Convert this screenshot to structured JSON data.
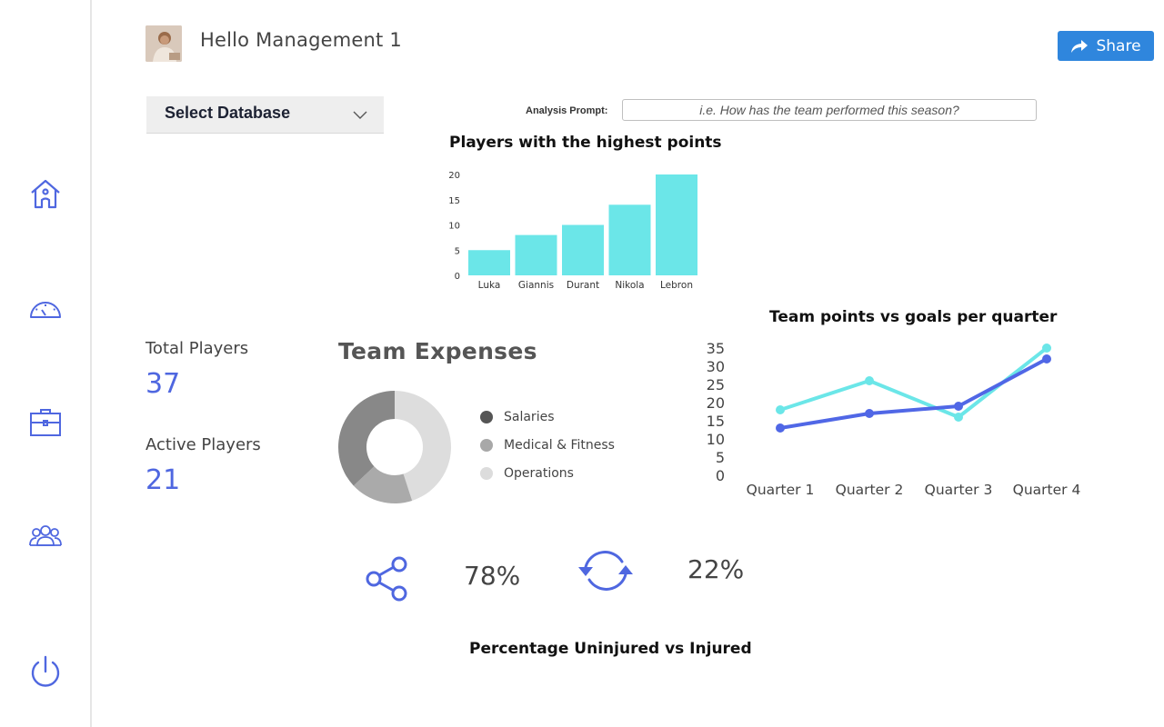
{
  "header": {
    "greeting": "Hello Management 1",
    "share_label": "Share"
  },
  "sidebar": {
    "items": [
      {
        "icon": "home-icon"
      },
      {
        "icon": "dashboard-gauge-icon"
      },
      {
        "icon": "briefcase-icon"
      },
      {
        "icon": "users-icon"
      },
      {
        "icon": "power-icon"
      }
    ]
  },
  "database_select": {
    "label": "Select Database"
  },
  "analysis": {
    "label": "Analysis Prompt:",
    "placeholder": "i.e. How has the team performed this season?"
  },
  "stats": {
    "total_players_label": "Total Players",
    "total_players_value": "37",
    "active_players_label": "Active Players",
    "active_players_value": "21"
  },
  "expenses": {
    "title": "Team Expenses",
    "legend": [
      "Salaries",
      "Medical & Fitness",
      "Operations"
    ]
  },
  "injury": {
    "uninjured_pct": "78%",
    "injured_pct": "22%",
    "title": "Percentage Uninjured  vs Injured"
  },
  "colors": {
    "bar": "#6be6e8",
    "line_a": "#6be6e8",
    "line_b": "#5067e6",
    "accent": "#2f86dd",
    "icon": "#4f67e0"
  },
  "chart_data": [
    {
      "type": "bar",
      "title": "Players with the highest points",
      "categories": [
        "Luka",
        "Giannis",
        "Durant",
        "Nikola",
        "Lebron"
      ],
      "values": [
        5,
        8,
        10,
        14,
        20
      ],
      "yticks": [
        0,
        5,
        10,
        15,
        20
      ],
      "ylim": [
        0,
        20
      ],
      "grid": false
    },
    {
      "type": "pie",
      "title": "Team Expenses",
      "labels": [
        "Salaries",
        "Medical & Fitness",
        "Operations"
      ],
      "values": [
        37,
        18,
        45
      ],
      "colors": [
        "#888888",
        "#aaaaaa",
        "#dddddd"
      ]
    },
    {
      "type": "line",
      "title": "Team points  vs goals per quarter",
      "categories": [
        "Quarter 1",
        "Quarter 2",
        "Quarter 3",
        "Quarter 4"
      ],
      "series": [
        {
          "values": [
            18,
            26,
            16,
            35
          ],
          "color": "#6be6e8"
        },
        {
          "values": [
            13,
            17,
            19,
            32
          ],
          "color": "#5067e6"
        }
      ],
      "yticks": [
        0,
        5,
        10,
        15,
        20,
        25,
        30,
        35
      ],
      "ylim": [
        0,
        35
      ],
      "grid": false
    }
  ]
}
